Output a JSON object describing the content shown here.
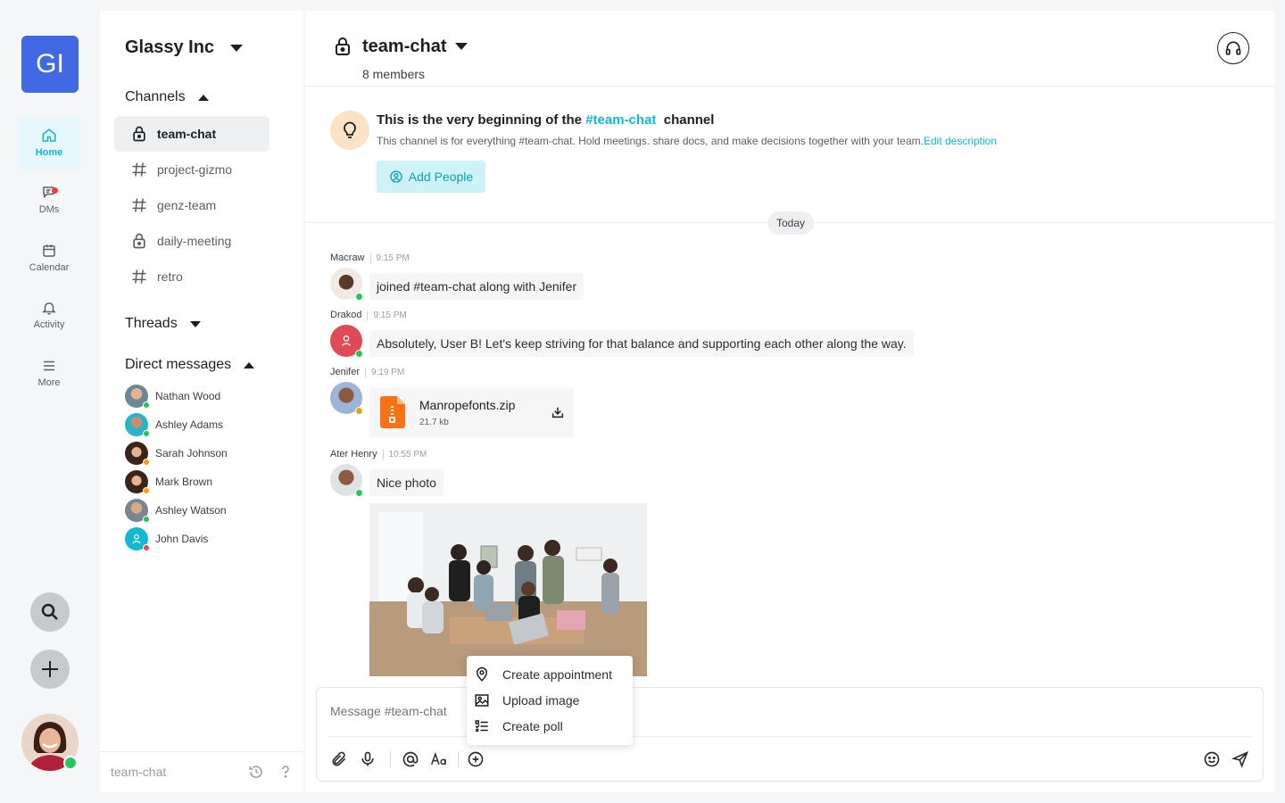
{
  "workspace": {
    "initials": "GI",
    "name": "Glassy Inc"
  },
  "rail": {
    "items": [
      {
        "label": "Home",
        "icon": "home-icon",
        "active": true
      },
      {
        "label": "DMs",
        "icon": "dms-icon"
      },
      {
        "label": "Calendar",
        "icon": "calendar-icon"
      },
      {
        "label": "Activity",
        "icon": "bell-icon"
      },
      {
        "label": "More",
        "icon": "menu-icon"
      }
    ]
  },
  "sidebar": {
    "channels_title": "Channels",
    "channels": [
      {
        "name": "team-chat",
        "type": "private",
        "active": true
      },
      {
        "name": "project-gizmo",
        "type": "public"
      },
      {
        "name": "genz-team",
        "type": "public"
      },
      {
        "name": "daily-meeting",
        "type": "private"
      },
      {
        "name": "retro",
        "type": "public"
      }
    ],
    "threads_title": "Threads",
    "dms_title": "Direct messages",
    "dms": [
      {
        "name": "Nathan Wood",
        "status": "online"
      },
      {
        "name": "Ashley Adams",
        "status": "online"
      },
      {
        "name": "Sarah Johnson",
        "status": "away"
      },
      {
        "name": "Mark Brown",
        "status": "away"
      },
      {
        "name": "Ashley Watson",
        "status": "online"
      },
      {
        "name": "John Davis",
        "status": "busy"
      }
    ],
    "footer_label": "team-chat"
  },
  "channel": {
    "name": "team-chat",
    "members": "8 members"
  },
  "intro": {
    "title_prefix": "This is the very beginning of the ",
    "title_tag": "#team-chat",
    "title_suffix": "  channel",
    "description": "This channel is for everything #team-chat. Hold meetings. share docs, and make decisions together with your team.",
    "edit_link": "Edit description",
    "add_people": "Add People"
  },
  "day_separator": "Today",
  "messages": [
    {
      "author": "Macraw",
      "time": "9:15 PM",
      "text": "joined #team-chat along with Jenifer"
    },
    {
      "author": "Drakod",
      "time": "9:15 PM",
      "text": "Absolutely, User B! Let's keep striving for that balance and supporting each other along the way."
    },
    {
      "author": "Jenifer",
      "time": "9:19 PM",
      "file": {
        "name": "Manropefonts.zip",
        "size": "21.7 kb"
      }
    },
    {
      "author": "Ater Henry",
      "time": "10:55 PM",
      "text": "Nice photo"
    }
  ],
  "attach_menu": {
    "items": [
      "Create appointment",
      "Upload image",
      "Create poll"
    ]
  },
  "composer": {
    "placeholder": "Message #team-chat"
  },
  "colors": {
    "accent": "#14b8d0",
    "brand": "#4169e1",
    "online": "#22c55e",
    "away": "#f59e0b",
    "busy": "#ef4444"
  }
}
